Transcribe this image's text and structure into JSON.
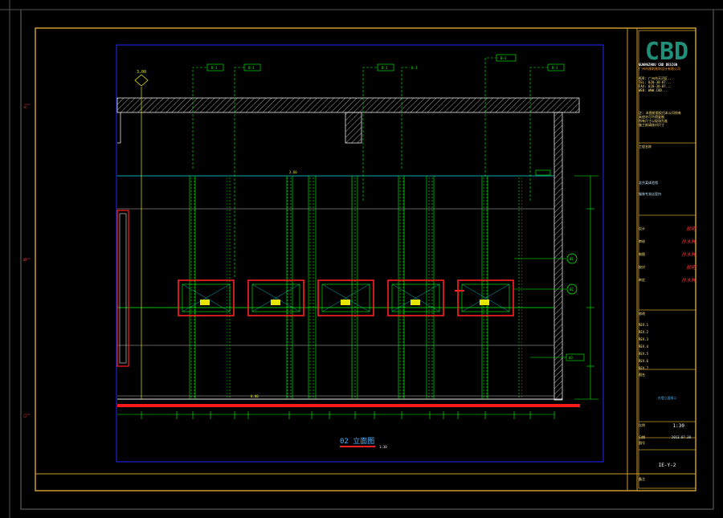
{
  "drawing": {
    "title": "02 立面图",
    "scale_note": "1:30",
    "top_level_mark": "3.00",
    "ceiling_mark": "2.60",
    "floor_mark": "0.00",
    "ceiling_tags": [
      "B-3",
      "B-3",
      "B-3",
      "B-3",
      "B-3",
      "B-3"
    ],
    "side_callouts": [
      "01",
      "02",
      "03"
    ],
    "panel_tag": "A-1"
  },
  "title_block": {
    "logo": "CBD",
    "company_en": "GUANGZHOU CBD DESIGN",
    "company_cn": "广州市建筑装饰设计有限公司",
    "company_lines": [
      "ADD: 广州市天河区...",
      "TEL: 020-38-87...",
      "FAX: 020-38-87...",
      "WEB: WWW.CBD..."
    ],
    "notes": [
      "注: 本图纸版权归本公司所有",
      "未经许可不得复制",
      "所有尺寸以现场为准",
      "施工前请核对尺寸"
    ],
    "project_label": "工程名称",
    "project_name_1": "北京某体验馆",
    "project_name_2": "服装专卖店室内",
    "roles": [
      {
        "label": "设计",
        "sig": "郝明"
      },
      {
        "label": "审核",
        "sig": "孙木林"
      },
      {
        "label": "制图",
        "sig": "孙木林"
      },
      {
        "label": "校对",
        "sig": "郝明"
      },
      {
        "label": "审定",
        "sig": "孙木林"
      }
    ],
    "revision_label": "修改",
    "revisions": [
      "REV.1",
      "REV.2",
      "REV.3",
      "REV.4",
      "REV.5",
      "REV.6",
      "REV.7"
    ],
    "drawing_name_label": "图名",
    "drawing_name": "内墙立面图二",
    "scale_label": "比例",
    "scale_value": "1:30",
    "date_label": "日期",
    "date_value": "2013.07.30",
    "number_label": "图号",
    "drawing_number": "IE-Y-2",
    "footer_label": "备注"
  }
}
